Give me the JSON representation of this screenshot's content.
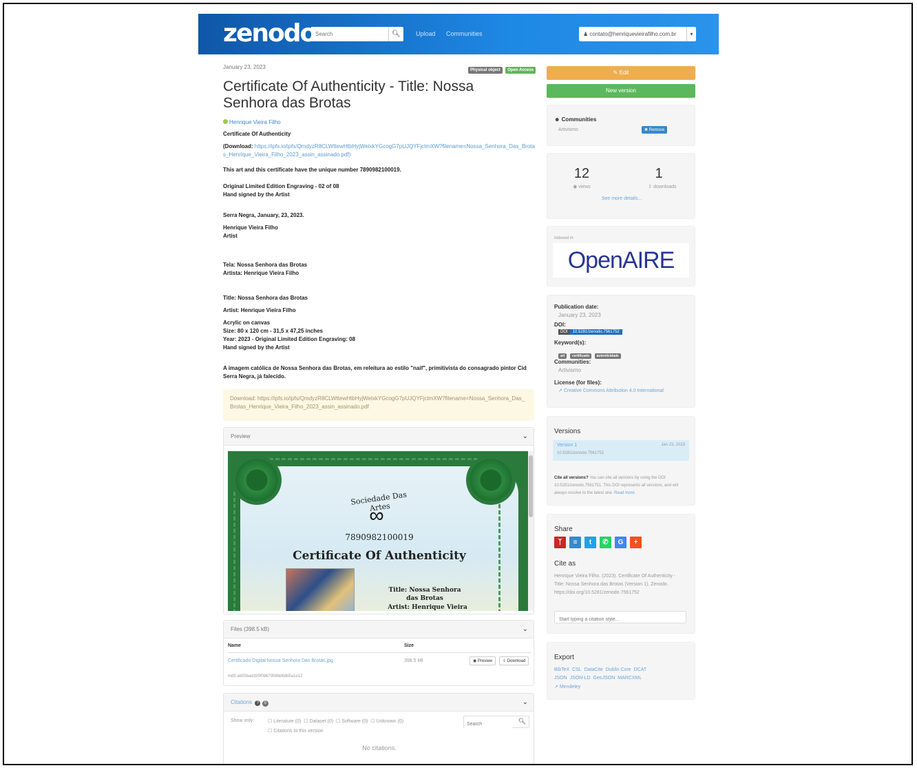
{
  "navbar": {
    "logo": "zenodo",
    "search_placeholder": "Search",
    "upload_label": "Upload",
    "communities_label": "Communities",
    "user_email": "contato@henriquevieirafilho.com.br"
  },
  "record": {
    "date": "January 23, 2023",
    "badges": [
      "Physical object",
      "Open Access"
    ],
    "title": "Certificate Of Authenticity - Title: Nossa Senhora das Brotas",
    "author": "Henrique Vieira Filho",
    "desc_heading": "Certificate Of Authenticity",
    "download_label": "(Download:",
    "download_url": "https://ipfs.io/ipfs/QmdyzR8CLWttewHtbHyjWelxkYGcogG7pUJQYFjctmXW?filename=Nossa_Senhora_Das_Brotas_Henrique_Vieira_Filho_2023_assin_assinado.pdf)",
    "unique_number": "This art and this certificate have the unique number 7890982100019.",
    "edition": "Original Limited Edition Engraving - 02 of 08",
    "hand_signed": "Hand signed by the Artist",
    "place_date": "Serra Negra, January, 23, 2023.",
    "artist_name": "Henrique Vieira Filho",
    "artist_role": "Artist",
    "tela": "Tela: Nossa Senhora das Brotas",
    "artista": "Artista: Henrique Vieira Filho",
    "title_line": "Title: Nossa Senhora das Brotas",
    "artist_line": "Artist: Henrique Vieira Filho",
    "medium": "Acrylic on canvas",
    "size": "Size: 80 x 120 cm - 31,5 x 47,25 inches",
    "year": "Year: 2023 - Original Limited Edition Engraving: 08",
    "hand_signed_2": "Hand signed by the Artist",
    "pt_description": "A imagem católica de Nossa Senhora das Brotas, em releitura ao estilo \"naif\", primitivista do consagrado pintor Cid Serra Negra, já falecido.",
    "alert_text": "Download: https://ipfs.io/ipfs/QmdyzR8CLWttewHtbHyjWelxkYGcogG7pUJQYFjctmXW?filename=Nossa_Senhora_Das_Brotas_Henrique_Vieira_Filho_2023_assin_assinado.pdf"
  },
  "preview": {
    "header": "Preview",
    "cert_society": "Sociedade Das Artes",
    "cert_number": "7890982100019",
    "cert_title": "Certificate Of Authenticity",
    "cert_work_title": "Title: Nossa Senhora das Brotas",
    "cert_artist": "Artist: Henrique Vieira Filho"
  },
  "files": {
    "header": "Files (398.5 kB)",
    "col_name": "Name",
    "col_size": "Size",
    "file_name": "Certificado Digital Nossa Senhora Das Brotas.jpg",
    "file_md5": "md5:ab55bad1b5f0b67058bb6db5a1e12",
    "file_size": "398.5 kB",
    "preview_btn": "Preview",
    "download_btn": "Download"
  },
  "citations": {
    "header": "Citations",
    "count": "0",
    "show_only": "Show only:",
    "filters": [
      "Literature (0)",
      "Dataset (0)",
      "Software (0)",
      "Unknown (0)"
    ],
    "this_version": "Citations to this version",
    "search_placeholder": "Search",
    "empty": "No citations."
  },
  "sidebar": {
    "edit_label": "Edit",
    "new_version_label": "New version",
    "communities_title": "Communities",
    "community_name": "Artivismo",
    "remove_label": "Remove",
    "views_count": "12",
    "views_label": "views",
    "downloads_count": "1",
    "downloads_label": "downloads",
    "more_details": "See more details...",
    "indexed_in": "Indexed in",
    "openaire": "OpenAIRE",
    "pub_date_label": "Publication date:",
    "pub_date": "January 23, 2023",
    "doi_label": "DOI:",
    "doi_prefix": "DOI",
    "doi_value": "10.5281/zenodo.7561752",
    "keywords_label": "Keyword(s):",
    "keywords": [
      "art",
      "certificado",
      "autenticidade"
    ],
    "communities_label": "Communities:",
    "communities_value": "Artivismo",
    "license_label": "License (for files):",
    "license_value": "Creative Commons Attribution 4.0 International",
    "versions_title": "Versions",
    "version_name": "Version 1",
    "version_doi": "10.5281/zenodo.7561752",
    "version_date": "Jan 23, 2023",
    "cite_all_bold": "Cite all versions?",
    "cite_all_text": "You can cite all versions by using the DOI 10.5281/zenodo.7561751. This DOI represents all versions, and will always resolve to the latest one.",
    "read_more": "Read more.",
    "share_title": "Share",
    "cite_as_title": "Cite as",
    "cite_as_text": "Henrique Vieira Filho. (2023). Certificate Of Authenticity - Title: Nossa Senhora das Brotas (Version 1). Zenodo. https://doi.org/10.5281/zenodo.7561752",
    "citation_style_placeholder": "Start typing a citation style...",
    "export_title": "Export",
    "export_row1": [
      "BibTeX",
      "CSL",
      "DataCite",
      "Dublin Core",
      "DCAT"
    ],
    "export_row2": [
      "JSON",
      "JSON-LD",
      "GeoJSON",
      "MARCXML"
    ],
    "mendeley": "Mendeley"
  },
  "colors": {
    "navbar": "#1e88e5",
    "edit": "#f0ad4e",
    "new_version": "#5cb85c",
    "physical_badge": "#777777",
    "open_access_badge": "#5cb85c",
    "doi_badge": "#1e6fbf"
  }
}
